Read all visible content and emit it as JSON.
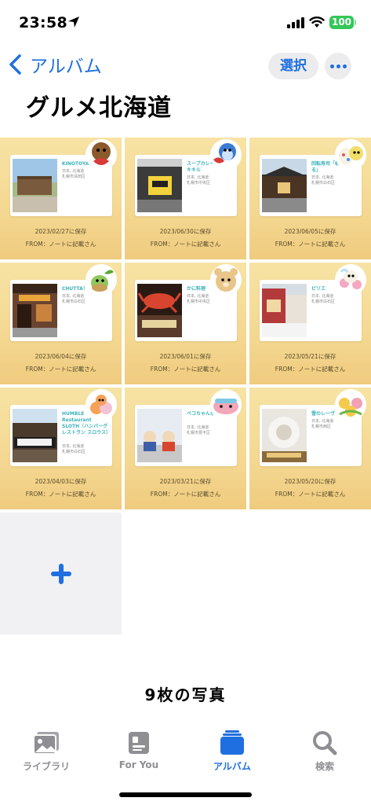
{
  "status_bar": {
    "time": "23:58",
    "battery": "100"
  },
  "nav": {
    "back_label": "アルバム",
    "select_label": "選択"
  },
  "album_title": "グルメ北海道",
  "tiles": [
    {
      "name": "KINOTOYA FARM",
      "addr1": "日本, 北海道",
      "addr2": "札幌市清田区",
      "date": "2023/02/27に保存",
      "from": "FROM：ノートに記載さん"
    },
    {
      "name": "スープカレートムトムキキル",
      "addr1": "日本, 北海道",
      "addr2": "札幌市中央区",
      "date": "2023/06/30に保存",
      "from": "FROM：ノートに記載さん"
    },
    {
      "name": "回転寿司「根室 花まる」",
      "addr1": "日本, 北海道",
      "addr2": "札幌市白石区",
      "date": "2023/06/05に保存",
      "from": "FROM：ノートに記載さん"
    },
    {
      "name": "CHUTTA！",
      "addr1": "日本, 北海道",
      "addr2": "札幌市白石区",
      "date": "2023/06/04に保存",
      "from": "FROM：ノートに記載さん"
    },
    {
      "name": "かに料理",
      "addr1": "日本, 北海道",
      "addr2": "札幌市中央区",
      "date": "2023/06/01に保存",
      "from": "FROM：ノートに記載さん"
    },
    {
      "name": "ピリエ",
      "addr1": "日本, 北海道",
      "addr2": "札幌市白石区",
      "date": "2023/05/21に保存",
      "from": "FROM：ノートに記載さん"
    },
    {
      "name": "HUMBLE Restaurant SLOTH（ハンバーグレストラン スロウス）",
      "addr1": "日本, 北海道",
      "addr2": "札幌市白石区",
      "date": "2023/04/03に保存",
      "from": "FROM：ノートに記載さん"
    },
    {
      "name": "ペコちゃんポコちゃん",
      "addr1": "日本, 北海道",
      "addr2": "札幌市豊平区",
      "date": "2023/03/21に保存",
      "from": "FROM：ノートに記載さん"
    },
    {
      "name": "雪のレーヴ",
      "addr1": "日本, 北海道",
      "addr2": "札幌市西区",
      "date": "2023/05/20に保存",
      "from": "FROM：ノートに記載さん"
    }
  ],
  "photo_count": "9枚の写真",
  "tabs": [
    {
      "label": "ライブラリ",
      "icon": "photo-library-icon"
    },
    {
      "label": "For You",
      "icon": "for-you-icon"
    },
    {
      "label": "アルバム",
      "icon": "albums-icon"
    },
    {
      "label": "検索",
      "icon": "search-icon"
    }
  ],
  "colors": {
    "accent": "#1f6fe0",
    "tile_bg": "#f4d892",
    "card_name": "#3bb3b8",
    "battery": "#34c759"
  }
}
